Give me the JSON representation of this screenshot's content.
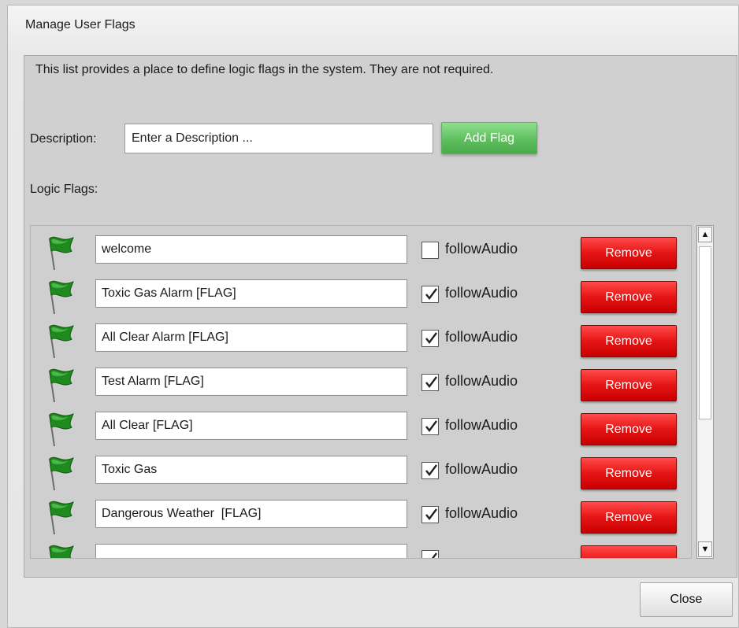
{
  "dialog": {
    "title": "Manage User Flags",
    "info": "This list provides a place to define logic flags in the system. They are not required.",
    "description_label": "Description:",
    "description_placeholder": "Enter a Description ...",
    "add_button": "Add Flag",
    "flags_label": "Logic Flags:",
    "close_button": "Close"
  },
  "flags": [
    {
      "name": "welcome",
      "follow_audio": false,
      "checkbox_label": "followAudio",
      "remove_label": "Remove"
    },
    {
      "name": "Toxic Gas Alarm [FLAG]",
      "follow_audio": true,
      "checkbox_label": "followAudio",
      "remove_label": "Remove"
    },
    {
      "name": "All Clear Alarm [FLAG]",
      "follow_audio": true,
      "checkbox_label": "followAudio",
      "remove_label": "Remove"
    },
    {
      "name": "Test Alarm [FLAG]",
      "follow_audio": true,
      "checkbox_label": "followAudio",
      "remove_label": "Remove"
    },
    {
      "name": "All Clear [FLAG]",
      "follow_audio": true,
      "checkbox_label": "followAudio",
      "remove_label": "Remove"
    },
    {
      "name": "Toxic Gas",
      "follow_audio": true,
      "checkbox_label": "followAudio",
      "remove_label": "Remove"
    },
    {
      "name": "Dangerous Weather  [FLAG]",
      "follow_audio": true,
      "checkbox_label": "followAudio",
      "remove_label": "Remove"
    },
    {
      "name": "",
      "follow_audio": true,
      "checkbox_label": "",
      "remove_label": ""
    }
  ],
  "scrollbar": {
    "up_icon": "arrow-up-icon",
    "down_icon": "arrow-down-icon"
  },
  "colors": {
    "add_green": "#5fbf5f",
    "remove_red": "#e61414",
    "flag_green": "#1e8a1e"
  }
}
